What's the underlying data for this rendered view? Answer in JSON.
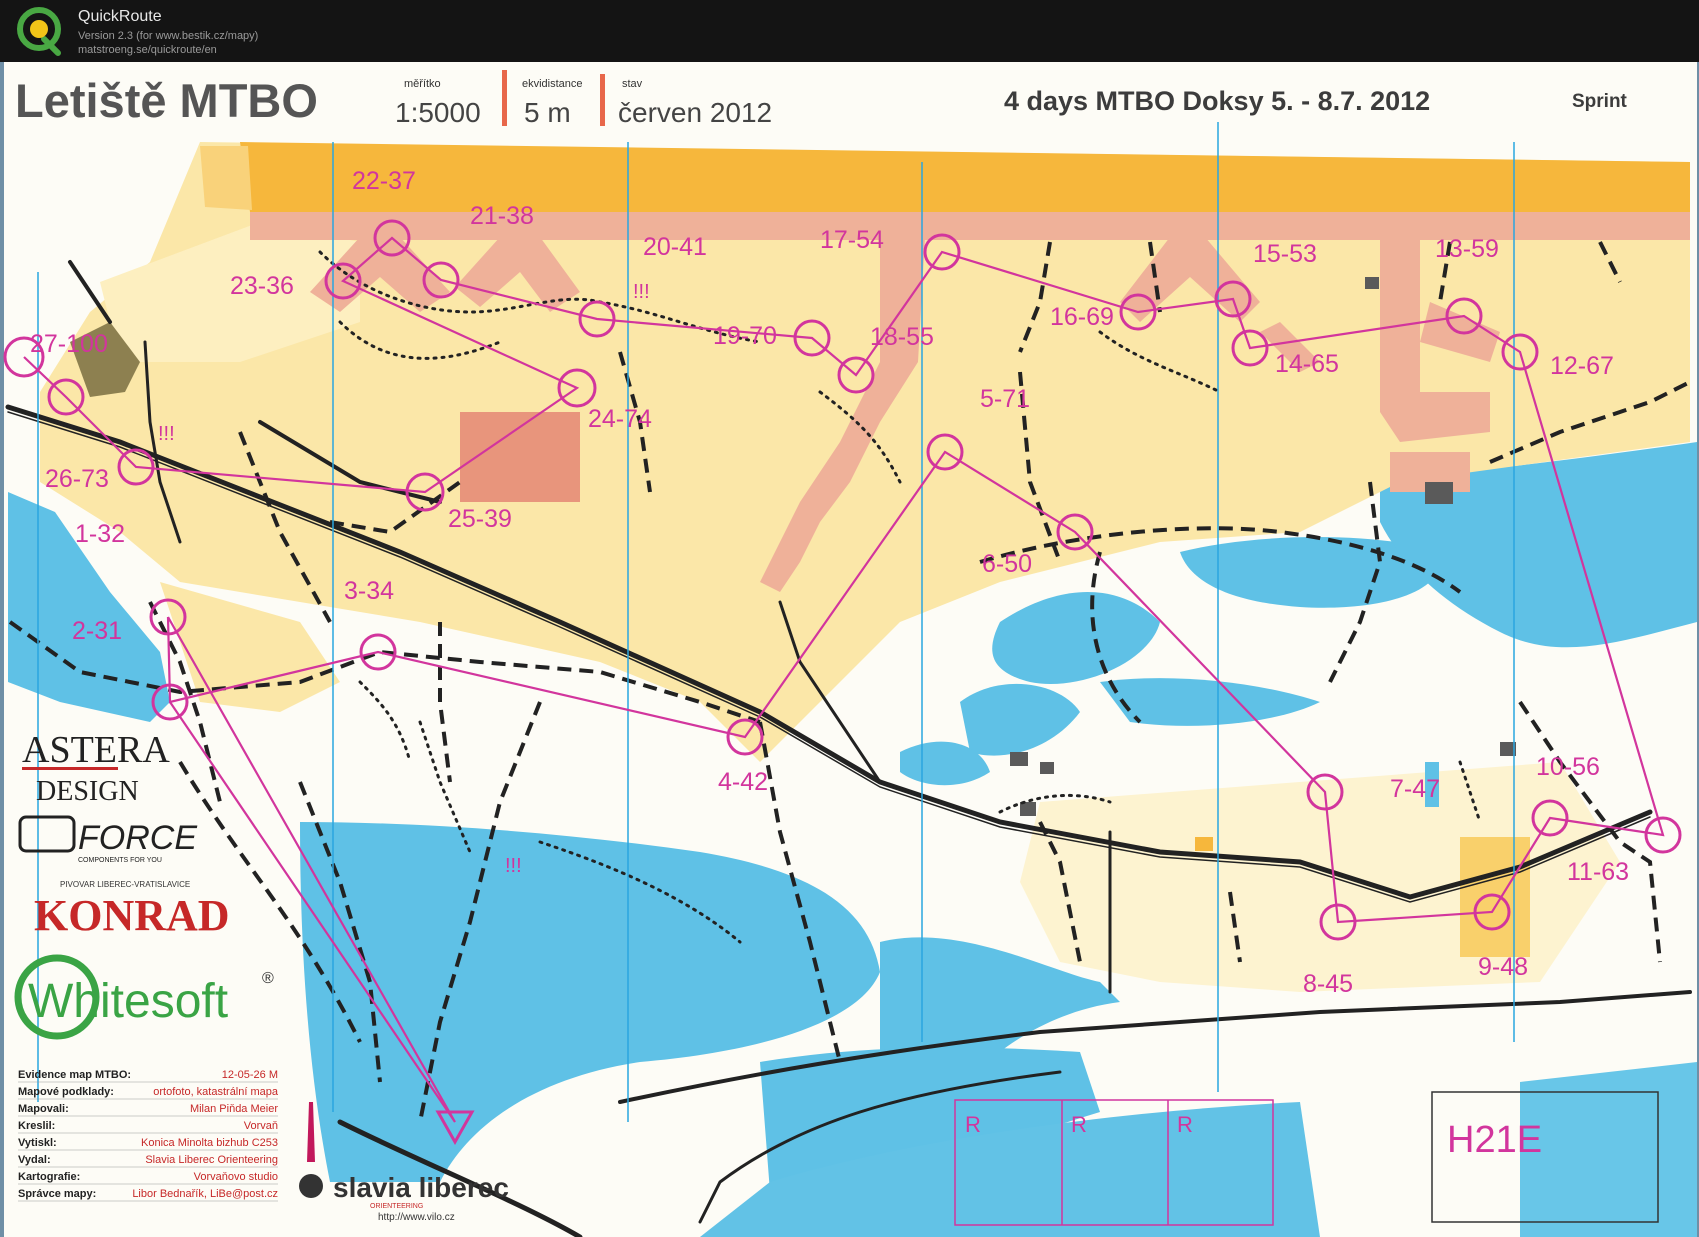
{
  "app": {
    "name": "QuickRoute",
    "version_line": "Version 2.3  (for www.bestik.cz/mapy)",
    "url_line": "matstroeng.se/quickroute/en"
  },
  "map": {
    "title": "Letiště MTBO",
    "scale_label": "měřítko",
    "scale": "1:5000",
    "equidistance_label": "ekvidistance",
    "equidistance": "5 m",
    "state_label": "stav",
    "state": "červen 2012",
    "event": "4 days  MTBO Doksy 5. - 8.7. 2012",
    "discipline": "Sprint",
    "category": "H21E",
    "warning": "!!!",
    "r_label": "R",
    "controls": [
      "1-32",
      "2-31",
      "3-34",
      "4-42",
      "5-71",
      "6-50",
      "7-47",
      "8-45",
      "9-48",
      "10-56",
      "11-63",
      "12-67",
      "13-59",
      "14-65",
      "15-53",
      "16-69",
      "17-54",
      "18-55",
      "19-70",
      "20-41",
      "21-38",
      "22-37",
      "23-36",
      "24-74",
      "25-39",
      "26-73",
      "27-100"
    ]
  },
  "sponsors": {
    "astera_1": "ASTERA",
    "astera_2": "DESIGN",
    "force": "FORCE",
    "force_sub": "COMPONENTS FOR YOU",
    "konrad_top": "PIVOVAR LIBEREC-VRATISLAVICE",
    "konrad": "KONRAD",
    "whitesoft": "Whitesoft",
    "whitesoft_mark": "®",
    "slavia": "slavia liberec",
    "slavia_sub": "ORIENTEERING",
    "slavia_url": "http://www.vilo.cz"
  },
  "credits": [
    {
      "label": "Evidence map MTBO:",
      "value": "12-05-26 M"
    },
    {
      "label": "Mapové podklady:",
      "value": "ortofoto, katastrální mapa"
    },
    {
      "label": "Mapovali:",
      "value": "Milan Piňda Meier"
    },
    {
      "label": "Kreslil:",
      "value": "Vorvaň"
    },
    {
      "label": "Vytiskl:",
      "value": "Konica Minolta bizhub C253"
    },
    {
      "label": "Vydal:",
      "value": "Slavia Liberec Orienteering"
    },
    {
      "label": "Kartografie:",
      "value": "Vorvaňovo studio"
    },
    {
      "label": "Správce mapy:",
      "value": "Libor Bednařík, LiBe@post.cz"
    }
  ],
  "colors": {
    "course": "#d2359d",
    "water": "#5fc1e6",
    "field": "#fbe7a8",
    "road": "#f6b73c",
    "building": "#e6957f",
    "track": "#222222"
  }
}
